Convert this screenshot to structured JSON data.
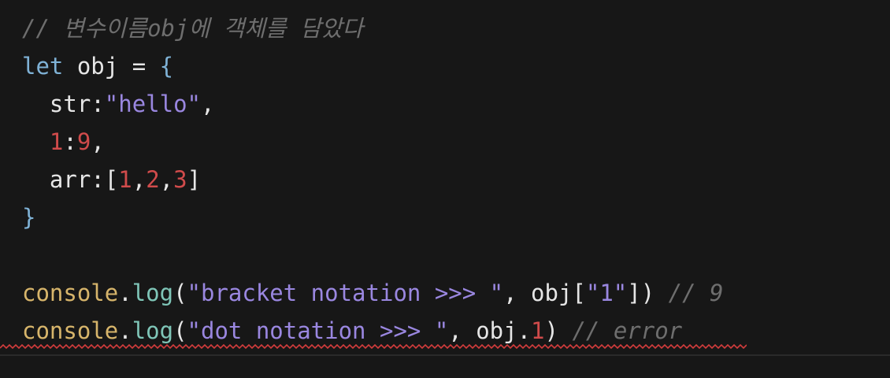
{
  "code": {
    "line1": {
      "comment": "// 변수이름obj에 객체를 담았다"
    },
    "line2": {
      "kw": "let",
      "name": " obj ",
      "eq": "= ",
      "brace": "{"
    },
    "line3": {
      "indent": "  ",
      "key": "str",
      "colon": ":",
      "value": "\"hello\"",
      "comma": ","
    },
    "line4": {
      "indent": "  ",
      "key": "1",
      "colon": ":",
      "value": "9",
      "comma": ","
    },
    "line5": {
      "indent": "  ",
      "key": "arr",
      "colon": ":",
      "open": "[",
      "v1": "1",
      "c1": ",",
      "v2": "2",
      "c2": ",",
      "v3": "3",
      "close": "]"
    },
    "line6": {
      "brace": "}"
    },
    "line8": {
      "obj": "console",
      "dot": ".",
      "method": "log",
      "open": "(",
      "string": "\"bracket notation >>> \"",
      "sep": ", obj[",
      "key": "\"1\"",
      "close": "])",
      "comment": " // 9"
    },
    "line9": {
      "obj": "console",
      "dot": ".",
      "method": "log",
      "open": "(",
      "string": "\"dot notation >>> \"",
      "sep": ", obj.",
      "num": "1",
      "close": ")",
      "comment": " // error"
    }
  },
  "colors": {
    "background": "#171717",
    "error_squiggle": "#d23c3c"
  }
}
